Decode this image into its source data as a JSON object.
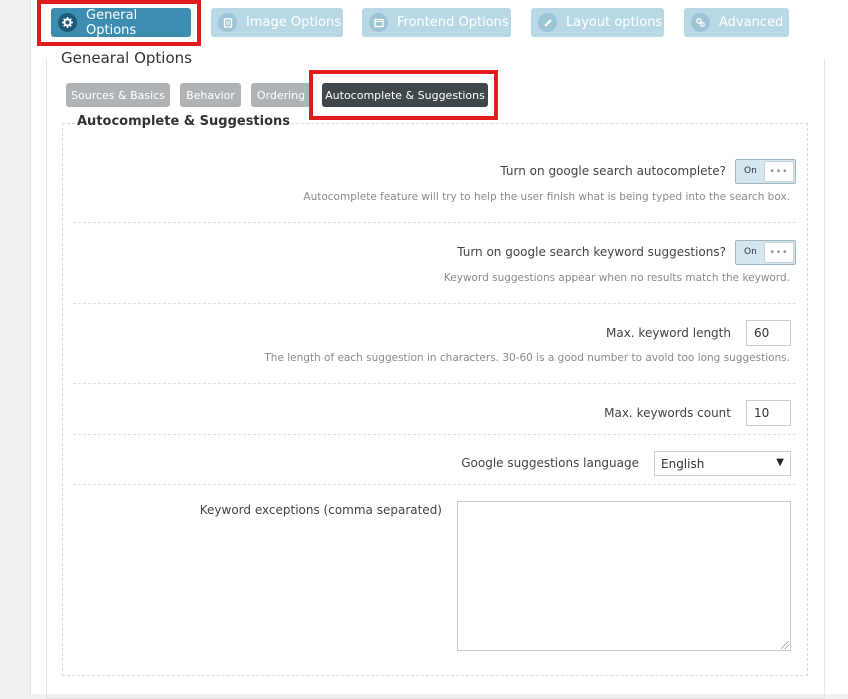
{
  "top_tabs": [
    {
      "label": "General Options",
      "icon": "gear-icon"
    },
    {
      "label": "Image Options",
      "icon": "image-icon"
    },
    {
      "label": "Frontend Options",
      "icon": "window-icon"
    },
    {
      "label": "Layout options",
      "icon": "pencil-icon"
    },
    {
      "label": "Advanced",
      "icon": "gears-icon"
    }
  ],
  "section_title": "Genearal Options",
  "sub_tabs": [
    {
      "label": "Sources & Basics"
    },
    {
      "label": "Behavior"
    },
    {
      "label": "Ordering"
    },
    {
      "label": "Autocomplete & Suggestions"
    }
  ],
  "panel_title": "Autocomplete & Suggestions",
  "options": {
    "autocomplete": {
      "label": "Turn on google search autocomplete?",
      "toggle": "On",
      "hint": "Autocomplete feature will try to help the user finish what is being typed into the search box."
    },
    "keyword_suggestions": {
      "label": "Turn on google search keyword suggestions?",
      "toggle": "On",
      "hint": "Keyword suggestions appear when no results match the keyword."
    },
    "max_keyword_length": {
      "label": "Max. keyword length",
      "value": "60",
      "hint": "The length of each suggestion in characters. 30-60 is a good number to avoid too long suggestions."
    },
    "max_keywords_count": {
      "label": "Max. keywords count",
      "value": "10"
    },
    "language": {
      "label": "Google suggestions language",
      "selected": "English"
    },
    "exceptions": {
      "label": "Keyword exceptions (comma separated)",
      "value": ""
    }
  },
  "colors": {
    "active_tab": "#3c8db0",
    "inactive_tab": "#b7d8e4",
    "highlight": "#e01b1b",
    "active_subtab": "#3f474b"
  }
}
